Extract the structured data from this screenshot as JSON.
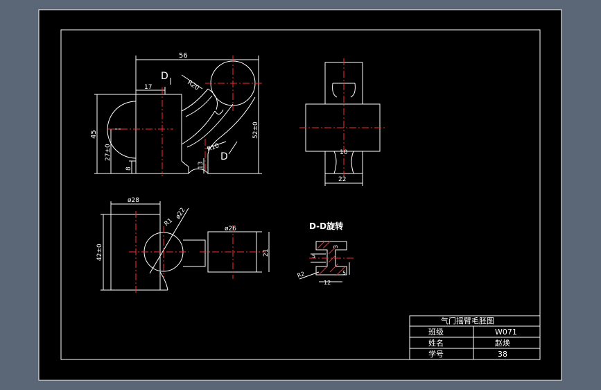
{
  "drawing": {
    "top_view": {
      "dim_width": "56",
      "dim_17": "17",
      "dim_r20": "R20",
      "dim_r10": "R10",
      "dim_height": "45",
      "dim_27": "27±0",
      "dim_8": "8",
      "dim_13": "13",
      "dim_52": "52±0",
      "section_mark_1": "D",
      "section_mark_2": "D"
    },
    "side_view": {
      "dim_10": "10",
      "dim_22": "22"
    },
    "bottom_view": {
      "dim_d28": "ø28",
      "dim_d22": "ø22",
      "dim_r1": "R1",
      "dim_42": "42±0",
      "dim_d26": "ø26",
      "dim_21": "21"
    },
    "section_view": {
      "title": "D-D旋转",
      "dim_r2": "R2",
      "dim_12": "12",
      "dim_5a": "5",
      "dim_5b": "5",
      "dim_3": "3"
    }
  },
  "title_block": {
    "title": "气门摇臂毛胚图",
    "row1_label": "班级",
    "row1_value": "W071",
    "row2_label": "姓名",
    "row2_value": "赵焕",
    "row3_label": "学号",
    "row3_value": "38"
  },
  "colors": {
    "background": "#5b6776",
    "sheet": "#000000",
    "line": "#ffffff",
    "centerline": "#ff2a2a"
  }
}
